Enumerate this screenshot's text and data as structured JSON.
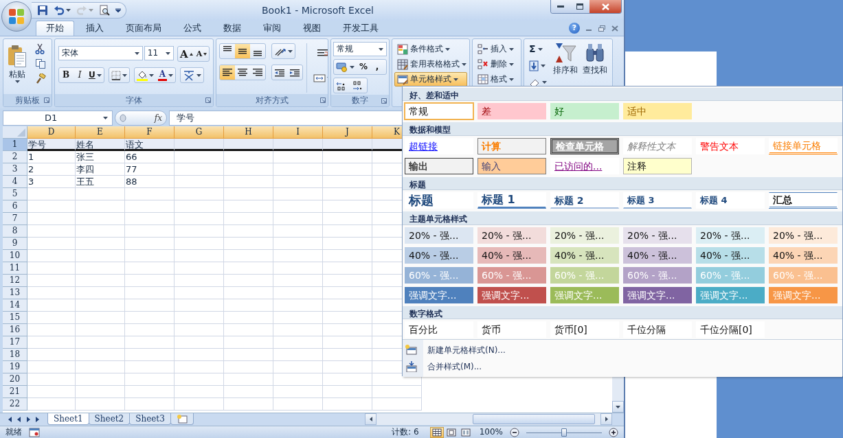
{
  "window": {
    "title": "Book1 - Microsoft Excel"
  },
  "quick_access": [
    {
      "kind": "save",
      "disabled": false
    },
    {
      "kind": "undo",
      "disabled": false
    },
    {
      "kind": "redo",
      "disabled": true
    },
    {
      "kind": "preview",
      "disabled": false
    }
  ],
  "tabs": [
    {
      "label": "开始",
      "selected": true
    },
    {
      "label": "插入",
      "selected": false
    },
    {
      "label": "页面布局",
      "selected": false
    },
    {
      "label": "公式",
      "selected": false
    },
    {
      "label": "数据",
      "selected": false
    },
    {
      "label": "审阅",
      "selected": false
    },
    {
      "label": "视图",
      "selected": false
    },
    {
      "label": "开发工具",
      "selected": false
    }
  ],
  "help": "?",
  "ribbon": {
    "clipboard": {
      "label": "剪贴板",
      "paste": "粘贴"
    },
    "font": {
      "label": "字体",
      "font_name": "宋体",
      "font_size": "11",
      "grow": "A",
      "shrink": "A",
      "bold": "B",
      "italic": "I",
      "underline": "U",
      "font_color": "A"
    },
    "alignment": {
      "label": "对齐方式",
      "vertical": [
        {
          "kind": "top",
          "selected": false
        },
        {
          "kind": "middle",
          "selected": true
        },
        {
          "kind": "bottom",
          "selected": false
        }
      ],
      "horizontal": [
        {
          "kind": "left",
          "selected": true
        },
        {
          "kind": "center",
          "selected": false
        },
        {
          "kind": "right",
          "selected": false
        }
      ]
    },
    "number": {
      "label": "数字",
      "format": "常规",
      "percent": "%",
      "comma": ","
    },
    "styles": [
      {
        "label": "条件格式",
        "kind": "conditional",
        "pressed": false
      },
      {
        "label": "套用表格格式",
        "kind": "table",
        "pressed": false
      },
      {
        "label": "单元格样式",
        "kind": "cellstyle",
        "pressed": true
      }
    ],
    "cells": [
      {
        "label": "插入",
        "kind": "insert"
      },
      {
        "label": "删除",
        "kind": "delete"
      },
      {
        "label": "格式",
        "kind": "format"
      }
    ],
    "editing": {
      "autosum": "Σ",
      "sort": "排序和",
      "find": "查找和"
    }
  },
  "formula_bar": {
    "name_box": "D1",
    "function_label": "fx",
    "formula": "学号"
  },
  "sheet": {
    "columns": [
      {
        "label": "D",
        "selected": true
      },
      {
        "label": "E",
        "selected": true
      },
      {
        "label": "F",
        "selected": true
      },
      {
        "label": "G",
        "selected": true
      },
      {
        "label": "H",
        "selected": true
      },
      {
        "label": "I",
        "selected": true
      },
      {
        "label": "J",
        "selected": true
      },
      {
        "label": "K",
        "selected": true
      }
    ],
    "rows": [
      {
        "header": "1",
        "selected": true,
        "border_bottom": true,
        "cells": [
          "学号",
          "姓名",
          "语文"
        ]
      },
      {
        "header": "2",
        "selected": false,
        "border_bottom": false,
        "cells": [
          "1",
          "张三",
          "66"
        ]
      },
      {
        "header": "3",
        "selected": false,
        "border_bottom": false,
        "cells": [
          "2",
          "李四",
          "77"
        ]
      },
      {
        "header": "4",
        "selected": false,
        "border_bottom": false,
        "cells": [
          "3",
          "王五",
          "88"
        ]
      },
      {
        "header": "5",
        "selected": false,
        "border_bottom": false
      },
      {
        "header": "6",
        "selected": false,
        "border_bottom": false
      },
      {
        "header": "7",
        "selected": false,
        "border_bottom": false
      },
      {
        "header": "8",
        "selected": false,
        "border_bottom": false
      },
      {
        "header": "9",
        "selected": false,
        "border_bottom": false
      },
      {
        "header": "10",
        "selected": false,
        "border_bottom": false
      },
      {
        "header": "11",
        "selected": false,
        "border_bottom": false
      },
      {
        "header": "12",
        "selected": false,
        "border_bottom": false
      },
      {
        "header": "13",
        "selected": false,
        "border_bottom": false
      },
      {
        "header": "14",
        "selected": false,
        "border_bottom": false
      },
      {
        "header": "15",
        "selected": false,
        "border_bottom": false
      },
      {
        "header": "16",
        "selected": false,
        "border_bottom": false
      },
      {
        "header": "17",
        "selected": false,
        "border_bottom": false
      },
      {
        "header": "18",
        "selected": false,
        "border_bottom": false
      },
      {
        "header": "19",
        "selected": false,
        "border_bottom": false
      },
      {
        "header": "20",
        "selected": false,
        "border_bottom": false
      },
      {
        "header": "21",
        "selected": false,
        "border_bottom": false
      },
      {
        "header": "22",
        "selected": false,
        "border_bottom": false
      }
    ]
  },
  "sheet_tabs": [
    {
      "label": "Sheet1",
      "selected": true
    },
    {
      "label": "Sheet2",
      "selected": false
    },
    {
      "label": "Sheet3",
      "selected": false
    }
  ],
  "status_bar": {
    "ready": "就绪",
    "count": "计数: 6",
    "views": [
      {
        "kind": "normal",
        "selected": true
      },
      {
        "kind": "layout",
        "selected": false
      },
      {
        "kind": "pagebreak",
        "selected": false
      }
    ],
    "zoom": "100%",
    "level": 0.5
  },
  "style_gallery": {
    "sections": [
      {
        "title": "好、差和适中",
        "rows": [
          [
            {
              "label": "常规",
              "kind": "normal",
              "selected": true
            },
            {
              "label": "差",
              "kind": "bad",
              "selected": false
            },
            {
              "label": "好",
              "kind": "good",
              "selected": false
            },
            {
              "label": "适中",
              "kind": "neutral",
              "selected": false
            }
          ]
        ]
      },
      {
        "title": "数据和模型",
        "rows": [
          [
            {
              "label": "超链接",
              "kind": "hyperlink",
              "selected": false
            },
            {
              "label": "计算",
              "kind": "calculation",
              "selected": false
            },
            {
              "label": "检查单元格",
              "kind": "check",
              "selected": false
            },
            {
              "label": "解释性文本",
              "kind": "explanatory",
              "selected": false
            },
            {
              "label": "警告文本",
              "kind": "warning",
              "selected": false
            },
            {
              "label": "链接单元格",
              "kind": "linked",
              "selected": false
            }
          ],
          [
            {
              "label": "输出",
              "kind": "output",
              "selected": false
            },
            {
              "label": "输入",
              "kind": "input",
              "selected": false
            },
            {
              "label": "已访问的...",
              "kind": "followed",
              "selected": false
            },
            {
              "label": "注释",
              "kind": "note",
              "selected": false
            }
          ]
        ]
      },
      {
        "title": "标题",
        "rows": [
          [
            {
              "label": "标题",
              "kind": "title",
              "selected": false
            },
            {
              "label": "标题 1",
              "kind": "heading1",
              "selected": false
            },
            {
              "label": "标题 2",
              "kind": "heading2",
              "selected": false
            },
            {
              "label": "标题 3",
              "kind": "heading3",
              "selected": false
            },
            {
              "label": "标题 4",
              "kind": "heading4",
              "selected": false
            },
            {
              "label": "汇总",
              "kind": "total",
              "selected": false
            }
          ]
        ]
      },
      {
        "title": "主题单元格样式",
        "rows": [
          [
            {
              "label": "20% - 强...",
              "kind": "accent20",
              "selected": false
            },
            {
              "label": "20% - 强...",
              "kind": "accent20",
              "selected": false
            },
            {
              "label": "20% - 强...",
              "kind": "accent20",
              "selected": false
            },
            {
              "label": "20% - 强...",
              "kind": "accent20",
              "selected": false
            },
            {
              "label": "20% - 强...",
              "kind": "accent20",
              "selected": false
            },
            {
              "label": "20% - 强...",
              "kind": "accent20",
              "selected": false
            }
          ],
          [
            {
              "label": "40% - 强...",
              "kind": "accent40",
              "selected": false
            },
            {
              "label": "40% - 强...",
              "kind": "accent40",
              "selected": false
            },
            {
              "label": "40% - 强...",
              "kind": "accent40",
              "selected": false
            },
            {
              "label": "40% - 强...",
              "kind": "accent40",
              "selected": false
            },
            {
              "label": "40% - 强...",
              "kind": "accent40",
              "selected": false
            },
            {
              "label": "40% - 强...",
              "kind": "accent40",
              "selected": false
            }
          ],
          [
            {
              "label": "60% - 强...",
              "kind": "accent60",
              "selected": false
            },
            {
              "label": "60% - 强...",
              "kind": "accent60",
              "selected": false
            },
            {
              "label": "60% - 强...",
              "kind": "accent60",
              "selected": false
            },
            {
              "label": "60% - 强...",
              "kind": "accent60",
              "selected": false
            },
            {
              "label": "60% - 强...",
              "kind": "accent60",
              "selected": false
            },
            {
              "label": "60% - 强...",
              "kind": "accent60",
              "selected": false
            }
          ],
          [
            {
              "label": "强调文字...",
              "kind": "accent",
              "color": "#4f81bd",
              "selected": false
            },
            {
              "label": "强调文字...",
              "kind": "accent",
              "color": "#c0504d",
              "selected": false
            },
            {
              "label": "强调文字...",
              "kind": "accent",
              "color": "#9bbb59",
              "selected": false
            },
            {
              "label": "强调文字...",
              "kind": "accent",
              "color": "#8064a2",
              "selected": false
            },
            {
              "label": "强调文字...",
              "kind": "accent",
              "color": "#4bacc6",
              "selected": false
            },
            {
              "label": "强调文字...",
              "kind": "accent",
              "color": "#f79646",
              "selected": false
            }
          ]
        ]
      },
      {
        "title": "数字格式",
        "rows": [
          [
            {
              "label": "百分比",
              "kind": "number",
              "selected": false
            },
            {
              "label": "货币",
              "kind": "number",
              "selected": false
            },
            {
              "label": "货币[0]",
              "kind": "number",
              "selected": false
            },
            {
              "label": "千位分隔",
              "kind": "number",
              "selected": false
            },
            {
              "label": "千位分隔[0]",
              "kind": "number",
              "selected": false
            }
          ]
        ]
      }
    ],
    "commands": [
      {
        "label": "新建单元格样式(N)...",
        "kind": "new"
      },
      {
        "label": "合并样式(M)...",
        "kind": "merge"
      }
    ]
  }
}
